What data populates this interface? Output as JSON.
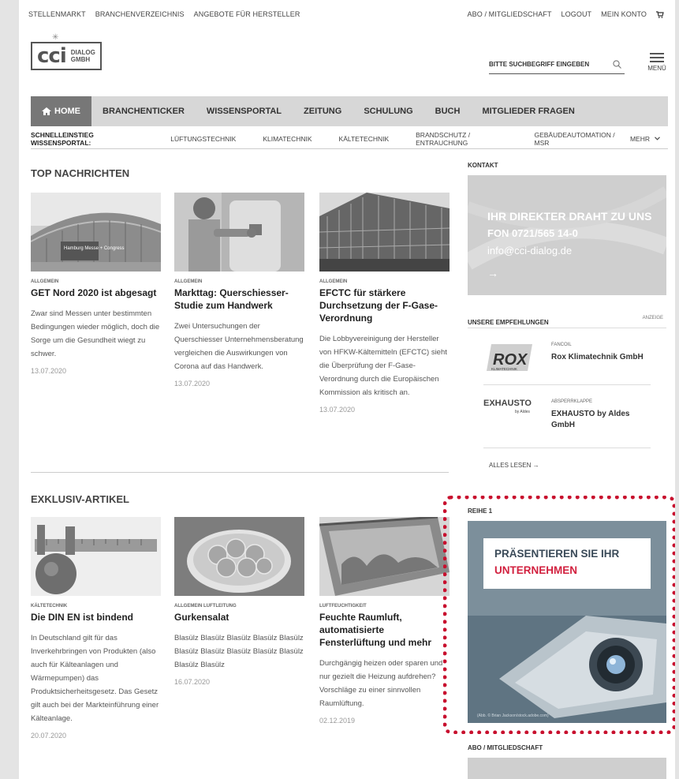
{
  "topbar": {
    "left": [
      "STELLENMARKT",
      "BRANCHENVERZEICHNIS",
      "ANGEBOTE FÜR HERSTELLER"
    ],
    "right": [
      "ABO / MITGLIEDSCHAFT",
      "LOGOUT",
      "MEIN KONTO"
    ]
  },
  "logo": {
    "main": "cci",
    "line1": "DIALOG",
    "line2": "GMBH"
  },
  "search": {
    "placeholder": "BITTE SUCHBEGRIFF EINGEBEN"
  },
  "menu": {
    "label": "MENÜ"
  },
  "mainnav": {
    "home": "HOME",
    "items": [
      "BRANCHENTICKER",
      "WISSENSPORTAL",
      "ZEITUNG",
      "SCHULUNG",
      "BUCH",
      "MITGLIEDER FRAGEN"
    ]
  },
  "subnav": {
    "lead": "SCHNELLEINSTIEG WISSENSPORTAL:",
    "items": [
      "LÜFTUNGSTECHNIK",
      "KLIMATECHNIK",
      "KÄLTETECHNIK",
      "BRANDSCHUTZ / ENTRAUCHUNG",
      "GEBÄUDEAUTOMATION / MSR"
    ],
    "more": "MEHR"
  },
  "top": {
    "title": "TOP NACHRICHTEN",
    "cards": [
      {
        "cat": "ALLGEMEIN",
        "headline": "GET Nord 2020 ist abgesagt",
        "teaser": "Zwar sind Messen unter bestimmten Bedingungen wieder möglich, doch die Sorge um die Gesundheit wiegt zu schwer.",
        "date": "13.07.2020",
        "sign": "Hamburg Messe + Congress"
      },
      {
        "cat": "ALLGEMEIN",
        "headline": "Markttag: Querschiesser-Studie zum Handwerk",
        "teaser": "Zwei Untersuchungen der Querschiesser Unternehmensberatung vergleichen die Auswirkungen von Corona auf das Handwerk.",
        "date": "13.07.2020"
      },
      {
        "cat": "ALLGEMEIN",
        "headline": "EFCTC für stärkere Durchsetzung der F-Gase-Verordnung",
        "teaser": "Die Lobbyvereinigung der Hersteller von HFKW-Kältemitteln (EFCTC) sieht die Überprüfung der F-Gase-Verordnung durch die Europäischen Kommission als kritisch an.",
        "date": "13.07.2020"
      }
    ]
  },
  "exklusiv": {
    "title": "EXKLUSIV-ARTIKEL",
    "cards": [
      {
        "cat": "KÄLTETECHNIK",
        "headline": "Die DIN EN ist bindend",
        "teaser": "In Deutschland gilt für das Inverkehrbringen von Produkten (also auch für Kälteanlagen und Wärmepumpen) das Produktsicherheitsgesetz. Das Gesetz gilt auch bei der Markteinführung einer Kälteanlage.",
        "date": "20.07.2020"
      },
      {
        "cat": "ALLGEMEIN  LUFTLEITUNG",
        "headline": "Gurkensalat",
        "teaser": "Blasülz Blasülz Blasülz Blasülz Blasülz Blasülz Blasülz Blasülz Blasülz Blasülz Blasülz Blasülz",
        "date": "16.07.2020"
      },
      {
        "cat": "LUFTFEUCHTIGKEIT",
        "headline": "Feuchte Raumluft, automatisierte Fensterlüftung und mehr",
        "teaser": "Durchgängig heizen oder sparen und nur gezielt die Heizung aufdrehen? Vorschläge zu einer sinnvollen Raumlüftung.",
        "date": "02.12.2019"
      }
    ]
  },
  "kontakt": {
    "label": "KONTAKT",
    "line1": "IHR DIREKTER DRAHT ZU UNS",
    "line2": "FON 0721/565 14-0",
    "line3": "info@cci-dialog.de",
    "arrow": "→"
  },
  "empfehlungen": {
    "label": "UNSERE EMPFEHLUNGEN",
    "anzeige": "ANZEIGE",
    "items": [
      {
        "logo": "ROX",
        "logo_sub": "KLIMATECHNIK",
        "cat": "FANCOIL",
        "name": "Rox Klimatechnik GmbH"
      },
      {
        "logo": "EXHAUSTO",
        "logo_sub": "by Aldes",
        "cat": "ABSPERRKLAPPE",
        "name": "EXHAUSTO by Aldes GmbH"
      }
    ],
    "more": "ALLES LESEN →"
  },
  "reihe": {
    "label": "REIHE 1",
    "line1": "PRÄSENTIEREN SIE IHR",
    "line2": "UNTERNEHMEN",
    "credit": "(Abb. © Brian Jackson/stock.adobe.com)"
  },
  "abo": {
    "label": "ABO / MITGLIEDSCHAFT"
  },
  "colors": {
    "accent_red": "#c8102e",
    "nav_active": "#777777",
    "nav_bg": "#d7d7d7"
  }
}
